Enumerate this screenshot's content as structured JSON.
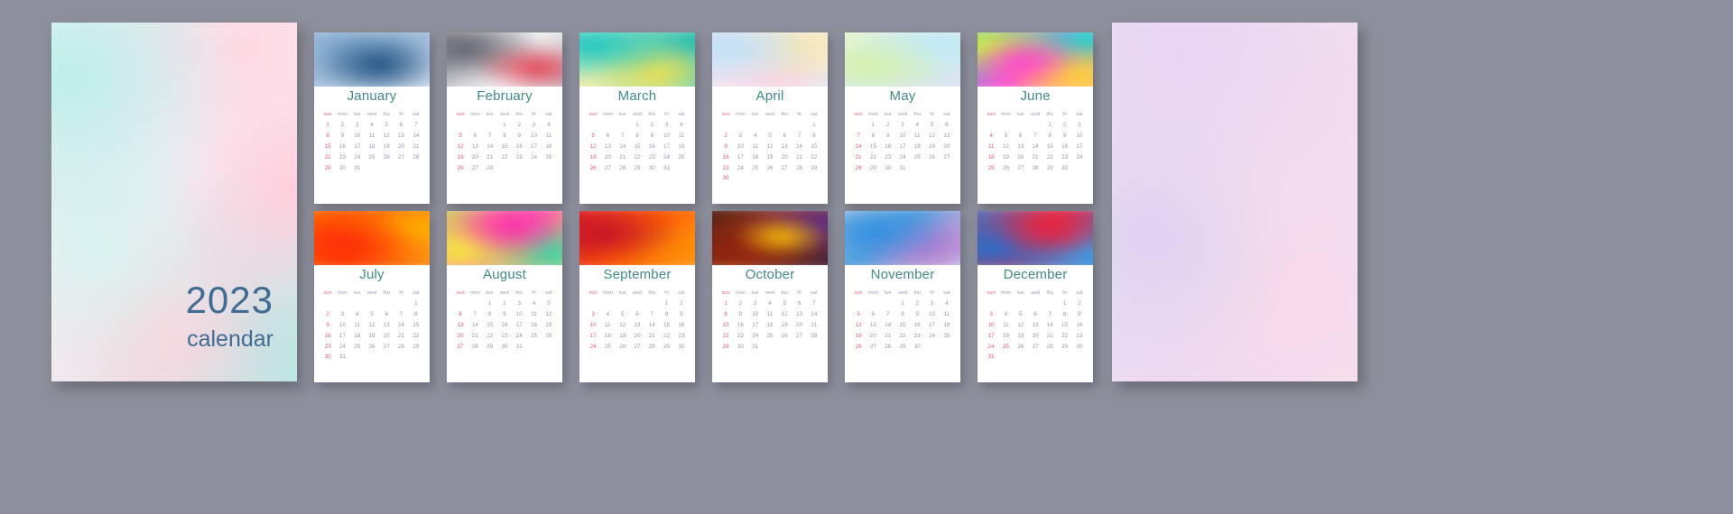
{
  "covers": {
    "left": {
      "name": "front-cover",
      "year": "2023",
      "subtitle": "calendar",
      "accent": "#3e6c93"
    },
    "right": {
      "name": "back-cover"
    }
  },
  "weekdays": [
    "sun",
    "mon",
    "tue",
    "wed",
    "thu",
    "fri",
    "sat"
  ],
  "colors": {
    "page_background": "#8d8f9c",
    "card_background": "#ffffff",
    "month_title": "#3e8a88",
    "weekday": "#9aa4b3",
    "weekday_sunday": "#e06a84",
    "day": "#8f9aa9",
    "day_sunday": "#e05a78",
    "cover_text": "#3e6c93"
  },
  "months": [
    {
      "name": "January",
      "start": 0,
      "days": 31,
      "holidays": [],
      "art": "blue-soft"
    },
    {
      "name": "February",
      "start": 3,
      "days": 28,
      "holidays": [],
      "art": "gray-red-white"
    },
    {
      "name": "March",
      "start": 3,
      "days": 31,
      "holidays": [],
      "art": "teal-yellow"
    },
    {
      "name": "April",
      "start": 6,
      "days": 30,
      "holidays": [],
      "art": "pastel-rainbow"
    },
    {
      "name": "May",
      "start": 1,
      "days": 31,
      "holidays": [],
      "art": "mint-lilac"
    },
    {
      "name": "June",
      "start": 4,
      "days": 30,
      "holidays": [],
      "art": "neon-magenta"
    },
    {
      "name": "July",
      "start": 6,
      "days": 31,
      "holidays": [],
      "art": "orange-red"
    },
    {
      "name": "August",
      "start": 2,
      "days": 31,
      "holidays": [],
      "art": "lime-magenta"
    },
    {
      "name": "September",
      "start": 5,
      "days": 30,
      "holidays": [],
      "art": "crimson-orange"
    },
    {
      "name": "October",
      "start": 0,
      "days": 31,
      "holidays": [],
      "art": "dark-amber"
    },
    {
      "name": "November",
      "start": 3,
      "days": 30,
      "holidays": [],
      "art": "blue-violet"
    },
    {
      "name": "December",
      "start": 5,
      "days": 31,
      "holidays": [
        25
      ],
      "art": "red-blue"
    }
  ]
}
